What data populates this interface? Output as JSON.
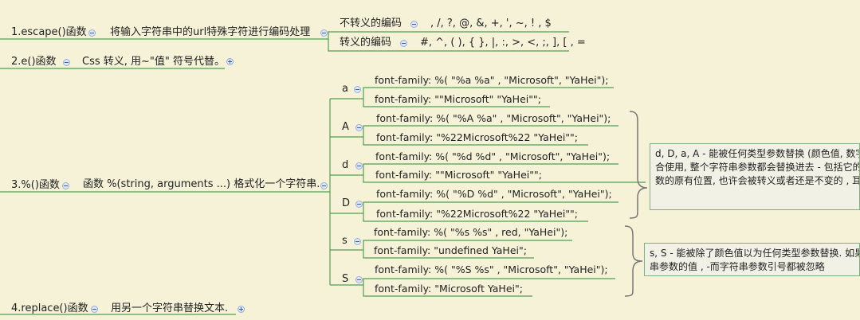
{
  "nodes": {
    "escape": {
      "title": "1.escape()函数",
      "desc": "将输入字符串中的url特殊字符进行编码处理",
      "not_escaped_label": "不转义的编码",
      "not_escaped_value": ", /, ?, @, &, +, ', ~, ! , $",
      "escaped_label": "转义的编码",
      "escaped_value": "#, ^, ( ), { }, |, :, >, <, ;, ], [ , ="
    },
    "e": {
      "title": "2.e()函数",
      "desc": "Css 转义, 用~\"值\" 符号代替。"
    },
    "format": {
      "title": "3.%()函数",
      "desc": "函数 %(string, arguments ...) 格式化一个字符串.",
      "branches": [
        {
          "key": "a",
          "rows": [
            "font-family: %( \"%a %a\" , \"Microsoft\", \"YaHei\");",
            "font-family: \"\"Microsoft\" \"YaHei\"\";"
          ]
        },
        {
          "key": "A",
          "rows": [
            "font-family: %( \"%A %a\" , \"Microsoft\", \"YaHei\");",
            "font-family: \"%22Microsoft%22 \"YaHei\"\";"
          ]
        },
        {
          "key": "d",
          "rows": [
            "font-family: %( \"%d %d\" , \"Microsoft\", \"YaHei\");",
            "font-family: \"\"Microsoft\" \"YaHei\"\";"
          ]
        },
        {
          "key": "D",
          "rows": [
            "font-family: %( \"%D %d\" , \"Microsoft\", \"YaHei\");",
            "font-family: \"%22Microsoft%22 \"YaHei\"\";"
          ]
        },
        {
          "key": "s",
          "rows": [
            "font-family: %( \"%s %s\" , red, \"YaHei\");",
            "font-family: \"undefined YaHei\";"
          ]
        },
        {
          "key": "S",
          "rows": [
            "font-family: %( \"%S %s\" , \"Microsoft\", \"YaHei\");",
            "font-family: \"Microsoft YaHei\";"
          ]
        }
      ],
      "note1_lines": [
        "d, D, a, A - 能被任何类型参数替换 (颜色值, 数字",
        "合使用, 整个字符串参数都会替换进去 - 包括它的",
        "数的原有位置, 也许会被转义或者还是不变的 , 耳"
      ],
      "note2_lines": [
        "s, S - 能被除了颜色值以为任何类型参数替换. 如果",
        "串参数的值 , -而字符串参数引号都被忽略"
      ]
    },
    "replace": {
      "title": "4.replace()函数",
      "desc": "用另一个字符串替换文本."
    }
  },
  "colors": {
    "background": "#F6F2D8",
    "connector": "#4FA050",
    "toggle": "#3B5FA8",
    "brace": "#777777"
  }
}
